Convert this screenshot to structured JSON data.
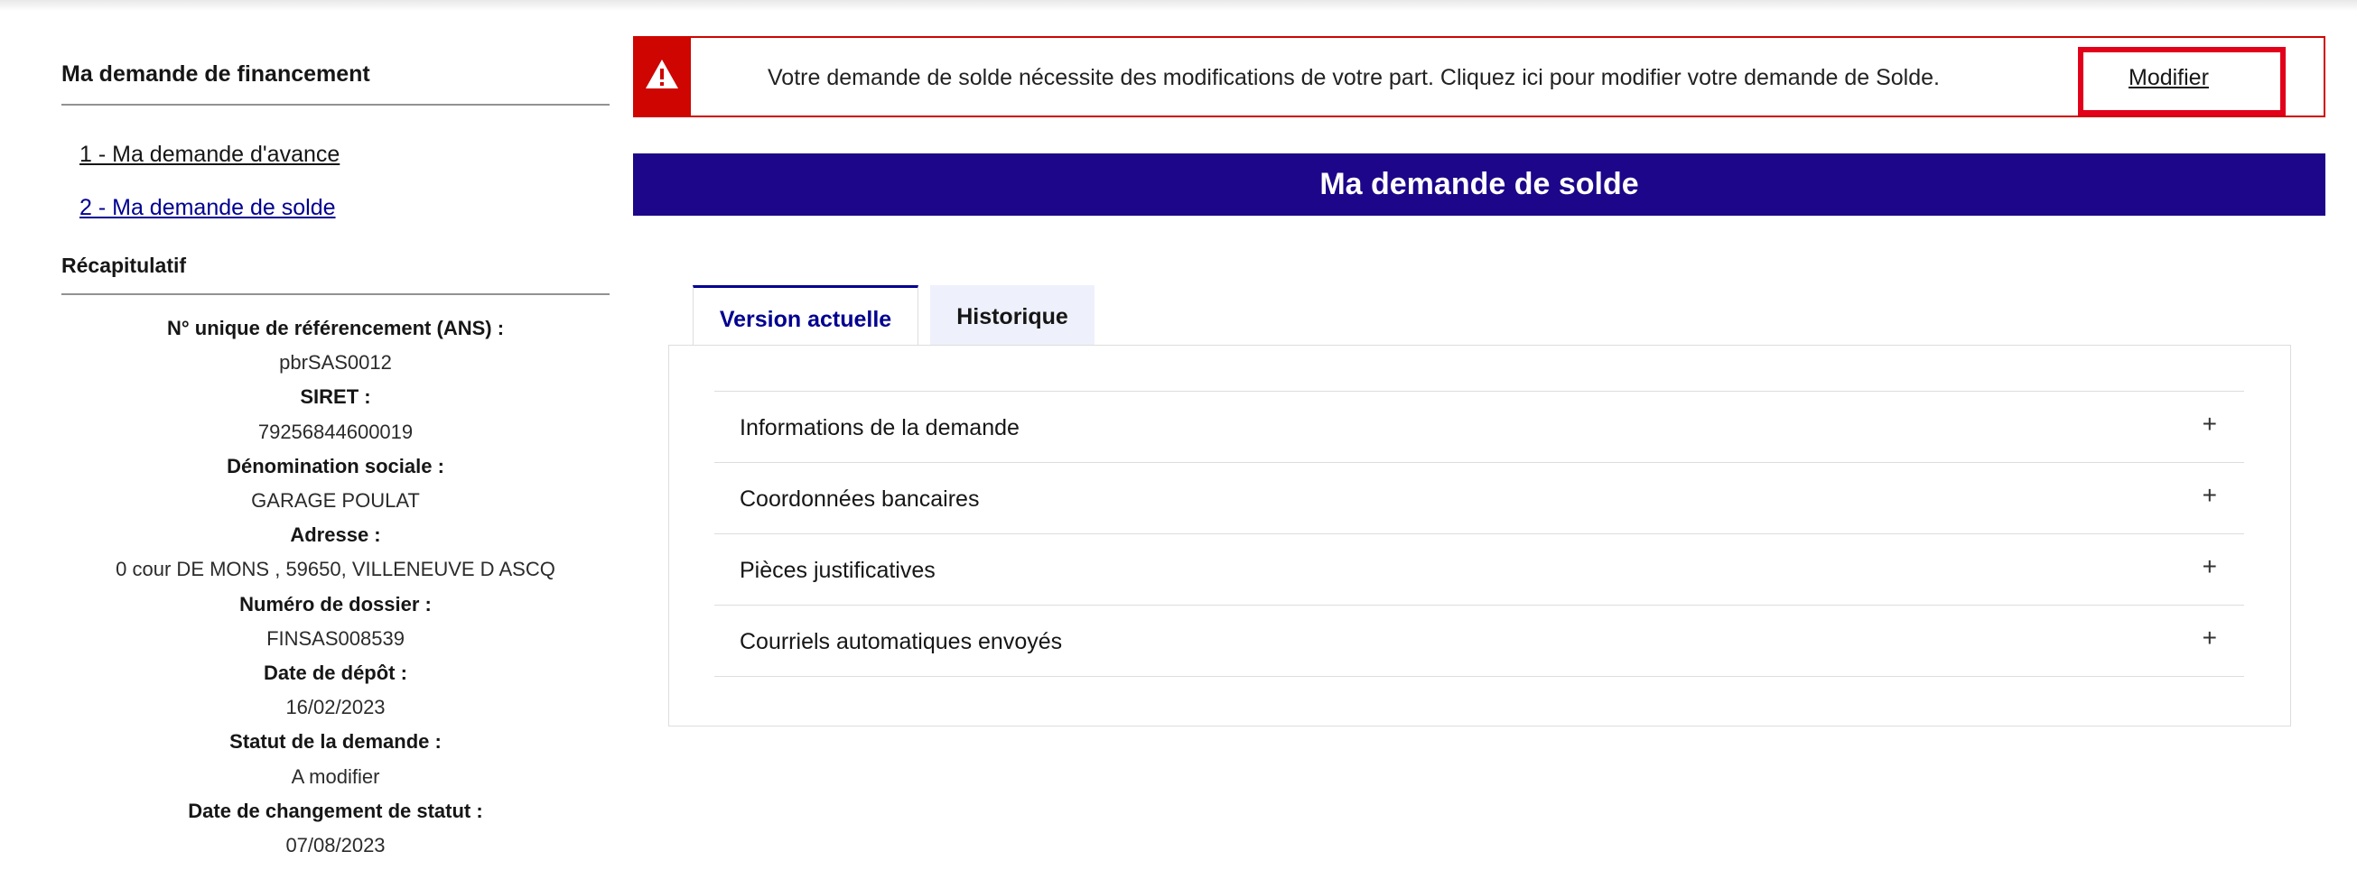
{
  "sidebar": {
    "title": "Ma demande de financement",
    "links": [
      "1 - Ma demande d'avance",
      "2 - Ma demande de solde"
    ],
    "recap_title": "Récapitulatif",
    "recap": [
      {
        "label": "N° unique de référencement (ANS) :",
        "value": "pbrSAS0012"
      },
      {
        "label": "SIRET :",
        "value": "79256844600019"
      },
      {
        "label": "Dénomination sociale :",
        "value": "GARAGE POULAT"
      },
      {
        "label": "Adresse :",
        "value": "0 cour DE MONS , 59650, VILLENEUVE D ASCQ"
      },
      {
        "label": "Numéro de dossier :",
        "value": "FINSAS008539"
      },
      {
        "label": "Date de dépôt :",
        "value": "16/02/2023"
      },
      {
        "label": "Statut de la demande :",
        "value": "A modifier"
      },
      {
        "label": "Date de changement de statut :",
        "value": "07/08/2023"
      }
    ]
  },
  "alert": {
    "message": "Votre demande de solde nécessite des modifications de votre part. Cliquez ici pour modifier votre demande de Solde.",
    "link": "Modifier",
    "icon": "warning-icon",
    "color": "#ce0500"
  },
  "banner": {
    "title": "Ma demande de solde",
    "color": "#1d0689"
  },
  "tabs": [
    "Version actuelle",
    "Historique"
  ],
  "accordion": [
    {
      "label": "Informations de la demande",
      "icon": "+"
    },
    {
      "label": "Coordonnées bancaires",
      "icon": "+"
    },
    {
      "label": "Pièces justificatives",
      "icon": "+"
    },
    {
      "label": "Courriels automatiques envoyés",
      "icon": "+"
    }
  ]
}
